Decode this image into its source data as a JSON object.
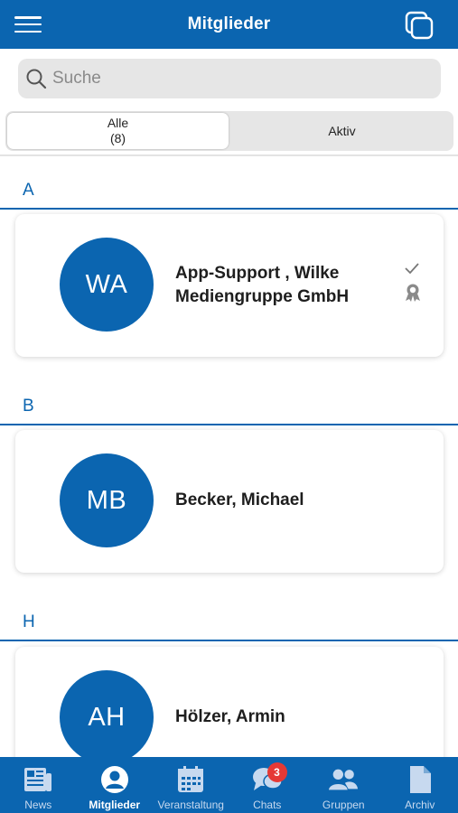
{
  "header": {
    "title": "Mitglieder",
    "left_icon": "hamburger-menu-icon",
    "right_icon": "copy-icon"
  },
  "search": {
    "placeholder": "Suche",
    "value": ""
  },
  "filter": {
    "tabs": [
      {
        "label": "Alle",
        "count": "(8)",
        "selected": true
      },
      {
        "label": "Aktiv",
        "count": "",
        "selected": false
      }
    ]
  },
  "sections": [
    {
      "letter": "A",
      "members": [
        {
          "initials": "WA",
          "name_line1": "App-Support , Wilke",
          "name_line2": "Mediengruppe GmbH",
          "status_icons": [
            "checkmark-icon",
            "award-ribbon-icon"
          ]
        }
      ]
    },
    {
      "letter": "B",
      "members": [
        {
          "initials": "MB",
          "name_line1": "Becker, Michael",
          "name_line2": ""
        }
      ]
    },
    {
      "letter": "H",
      "members": [
        {
          "initials": "AH",
          "name_line1": "Hölzer, Armin",
          "name_line2": ""
        }
      ]
    }
  ],
  "bottom_nav": [
    {
      "label": "News",
      "icon": "newspaper-icon",
      "active": false
    },
    {
      "label": "Mitglieder",
      "icon": "user-circle-icon",
      "active": true
    },
    {
      "label": "Veranstaltung",
      "icon": "calendar-icon",
      "active": false
    },
    {
      "label": "Chats",
      "icon": "chat-bubbles-icon",
      "active": false,
      "badge": "3"
    },
    {
      "label": "Gruppen",
      "icon": "group-icon",
      "active": false
    },
    {
      "label": "Archiv",
      "icon": "document-icon",
      "active": false
    }
  ],
  "colors": {
    "primary": "#0b65b0",
    "badge": "#e53935",
    "background": "#ffffff",
    "search_bg": "#e6e6e6"
  }
}
